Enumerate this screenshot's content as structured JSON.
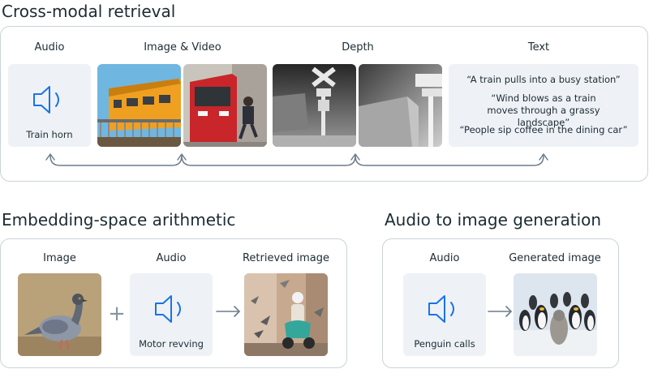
{
  "cross_modal": {
    "title": "Cross-modal retrieval",
    "audio_label": "Audio",
    "image_video_label": "Image & Video",
    "depth_label": "Depth",
    "text_label": "Text",
    "audio_caption": "Train horn",
    "quotes": [
      "“A train pulls into a busy station”",
      "“Wind blows as a train moves through a grassy landscape”",
      "“People sip coffee in the dining car”"
    ]
  },
  "arithmetic": {
    "title": "Embedding-space arithmetic",
    "image_label": "Image",
    "audio_label": "Audio",
    "retrieved_label": "Retrieved image",
    "audio_caption": "Motor revving",
    "plus": "+"
  },
  "generation": {
    "title": "Audio to image generation",
    "audio_label": "Audio",
    "generated_label": "Generated image",
    "audio_caption": "Penguin calls"
  },
  "colors": {
    "accent_blue": "#1a73e8",
    "panel_border": "#cbd2d9",
    "card_bg": "#eef2f7",
    "arrow_gray": "#6b7d8c"
  },
  "icons": [
    "speaker-icon",
    "arrow-right-icon",
    "plus-icon"
  ]
}
